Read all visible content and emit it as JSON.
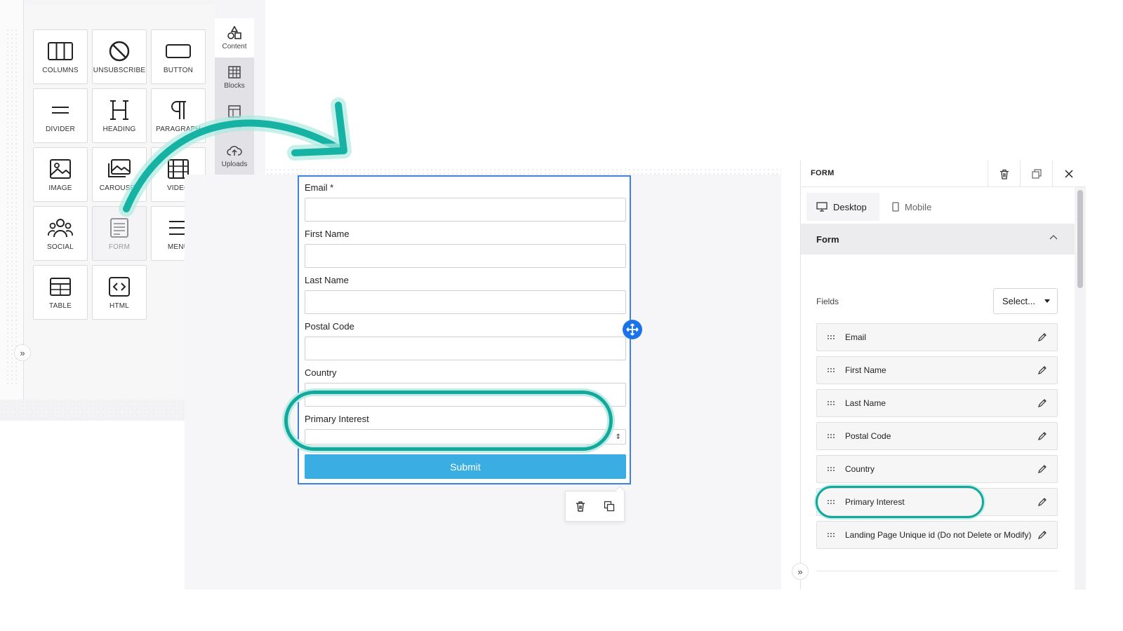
{
  "tools": [
    {
      "label": "COLUMNS",
      "icon": "columns-icon"
    },
    {
      "label": "UNSUBSCRIBE",
      "icon": "unsubscribe-icon"
    },
    {
      "label": "BUTTON",
      "icon": "button-icon"
    },
    {
      "label": "DIVIDER",
      "icon": "divider-icon"
    },
    {
      "label": "HEADING",
      "icon": "heading-icon"
    },
    {
      "label": "PARAGRAPH",
      "icon": "paragraph-icon"
    },
    {
      "label": "IMAGE",
      "icon": "image-icon"
    },
    {
      "label": "CAROUSEL",
      "icon": "carousel-icon"
    },
    {
      "label": "VIDEO",
      "icon": "video-icon"
    },
    {
      "label": "SOCIAL",
      "icon": "social-icon"
    },
    {
      "label": "FORM",
      "icon": "form-icon"
    },
    {
      "label": "MENU",
      "icon": "menu-icon"
    },
    {
      "label": "TABLE",
      "icon": "table-icon"
    },
    {
      "label": "HTML",
      "icon": "html-icon"
    }
  ],
  "side_tabs": [
    {
      "label": "Content",
      "icon": "shapes-icon"
    },
    {
      "label": "Blocks",
      "icon": "blocks-icon"
    },
    {
      "label": "Body",
      "icon": "body-icon"
    },
    {
      "label": "Uploads",
      "icon": "cloud-upload-icon"
    }
  ],
  "form": {
    "fields": [
      {
        "label": "Email *"
      },
      {
        "label": "First Name"
      },
      {
        "label": "Last Name"
      },
      {
        "label": "Postal Code"
      },
      {
        "label": "Country"
      },
      {
        "label": "Primary Interest"
      }
    ],
    "submit_label": "Submit"
  },
  "props": {
    "title": "FORM",
    "tabs": {
      "desktop": "Desktop",
      "mobile": "Mobile"
    },
    "section": "Form",
    "fields_label": "Fields",
    "select_label": "Select...",
    "field_rows": [
      "Email",
      "First Name",
      "Last Name",
      "Postal Code",
      "Country",
      "Primary Interest",
      "Landing Page Unique id (Do not Delete or Modify)"
    ]
  },
  "colors": {
    "accent": "#1a73e8",
    "submit": "#3aaee2",
    "highlight": "#12a89b",
    "selection": "#3b82e6"
  }
}
